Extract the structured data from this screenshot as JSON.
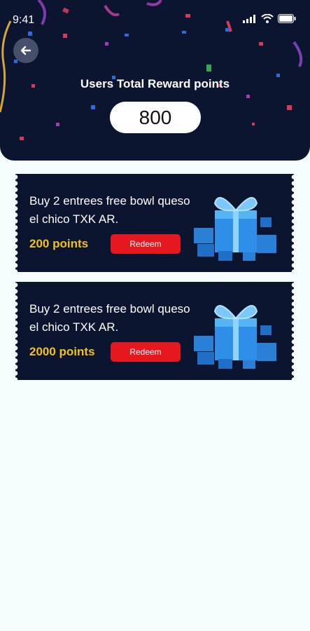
{
  "status_bar": {
    "time": "9:41"
  },
  "header": {
    "title": "Users Total Reward points",
    "total_points": "800"
  },
  "rewards": [
    {
      "description": "Buy 2 entrees free bowl queso el chico TXK AR.",
      "points": "200 points",
      "redeem_label": "Redeem"
    },
    {
      "description": "Buy 2 entrees free bowl queso el chico TXK AR.",
      "points": "2000 points",
      "redeem_label": "Redeem"
    }
  ],
  "colors": {
    "header_bg": "#0b1530",
    "points_accent": "#f3c11a",
    "redeem_bg": "#e5171f",
    "page_bg": "#f6fdff"
  }
}
